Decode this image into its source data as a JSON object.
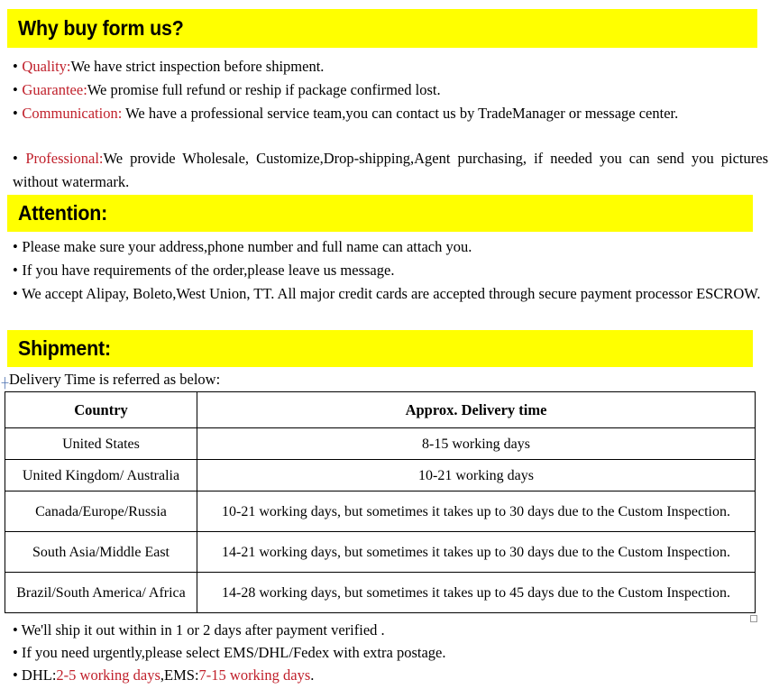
{
  "sections": {
    "why": {
      "heading": "Why buy form us?",
      "bullets": [
        {
          "bullet": "•",
          "keyword": "Quality:",
          "text": "We have strict inspection before shipment."
        },
        {
          "bullet": "•",
          "keyword": "Guarantee:",
          "text": "We promise full refund or reship if package confirmed lost."
        },
        {
          "bullet": "•",
          "keyword": "Communication:",
          "text": " We have a professional service team,you can contact us by TradeManager or message center."
        },
        {
          "bullet": "•",
          "keyword": "Professional:",
          "text": "We provide Wholesale, Customize,Drop-shipping,Agent purchasing, if needed you can send you pictures without watermark."
        }
      ]
    },
    "attention": {
      "heading": "Attention:",
      "bullets": [
        {
          "bullet": "•",
          "text": "Please make sure your address,phone number and full name can attach you."
        },
        {
          "bullet": "•",
          "text": "If you have requirements of the order,please leave us message."
        },
        {
          "bullet": "•",
          "text": "We accept Alipay, Boleto,West Union, TT. All major credit cards are accepted through secure payment processor ESCROW."
        }
      ]
    },
    "shipment": {
      "heading": "Shipment:",
      "lead": "Delivery Time is referred as below:",
      "table": {
        "headers": [
          "Country",
          "Approx. Delivery time"
        ],
        "rows": [
          [
            "United States",
            "8-15 working days"
          ],
          [
            "United Kingdom/ Australia",
            "10-21 working days"
          ],
          [
            "Canada/Europe/Russia",
            "10-21 working days, but sometimes it takes up to 30 days due to the Custom Inspection."
          ],
          [
            "South Asia/Middle East",
            "14-21 working days, but sometimes it takes up to 30 days due to the Custom Inspection."
          ],
          [
            "Brazil/South America/ Africa",
            "14-28 working days, but sometimes it takes up to 45 days due to the Custom Inspection."
          ]
        ]
      },
      "notes": [
        {
          "bullet": "•",
          "text": "We'll ship it out within in 1 or 2 days after payment verified ."
        },
        {
          "bullet": "•",
          "text": "If you need urgently,please select EMS/DHL/Fedex with extra postage."
        }
      ],
      "courier_note": {
        "bullet": "•",
        "dhl_label": "DHL:",
        "dhl_value": "2-5 working days",
        "separator": ",EMS:",
        "ems_value": "7-15 working days",
        "period": "."
      }
    }
  },
  "icons": {
    "table_move_handle": "table-move-handle-icon",
    "table_resize_handle": "table-resize-handle-icon"
  },
  "colors": {
    "highlight": "#FFFF00",
    "keyword_red": "#C0202B",
    "text": "#000000",
    "border": "#000000"
  }
}
